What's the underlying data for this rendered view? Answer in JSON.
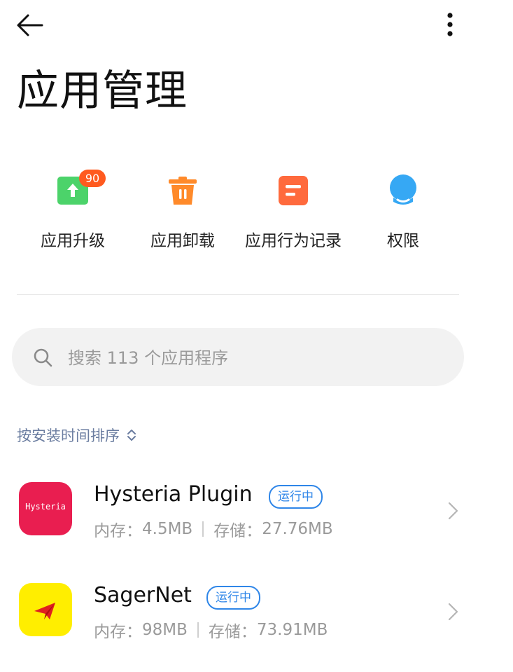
{
  "header": {
    "back_icon": "arrow-left-icon",
    "more_icon": "more-vertical-icon",
    "title": "应用管理"
  },
  "quick_actions": [
    {
      "label": "应用升级",
      "icon": "upgrade-icon",
      "badge": "90",
      "color": "#4cd36a"
    },
    {
      "label": "应用卸载",
      "icon": "trash-icon",
      "color": "#ff8a2a"
    },
    {
      "label": "应用行为记录",
      "icon": "behavior-record-icon",
      "color": "#ff6a3d"
    },
    {
      "label": "权限",
      "icon": "permission-icon",
      "color": "#36a8f4"
    }
  ],
  "search": {
    "placeholder": "搜索 113 个应用程序",
    "icon": "search-icon"
  },
  "sort": {
    "label": "按安装时间排序",
    "icon": "sort-toggle-icon"
  },
  "apps": [
    {
      "name": "Hysteria Plugin",
      "status": "运行中",
      "memory_label": "内存：",
      "memory": "4.5MB",
      "storage_label": "存储：",
      "storage": "27.76MB",
      "icon_text": "Hysteria",
      "icon_color": "#e91e50"
    },
    {
      "name": "SagerNet",
      "status": "运行中",
      "memory_label": "内存：",
      "memory": "98MB",
      "storage_label": "存储：",
      "storage": "73.91MB",
      "icon": "paper-plane-icon",
      "icon_color": "#ffee00"
    }
  ],
  "colors": {
    "accent_blue": "#2f86e8",
    "badge_orange": "#ff5a1f",
    "sort_text": "#6b7da0"
  }
}
